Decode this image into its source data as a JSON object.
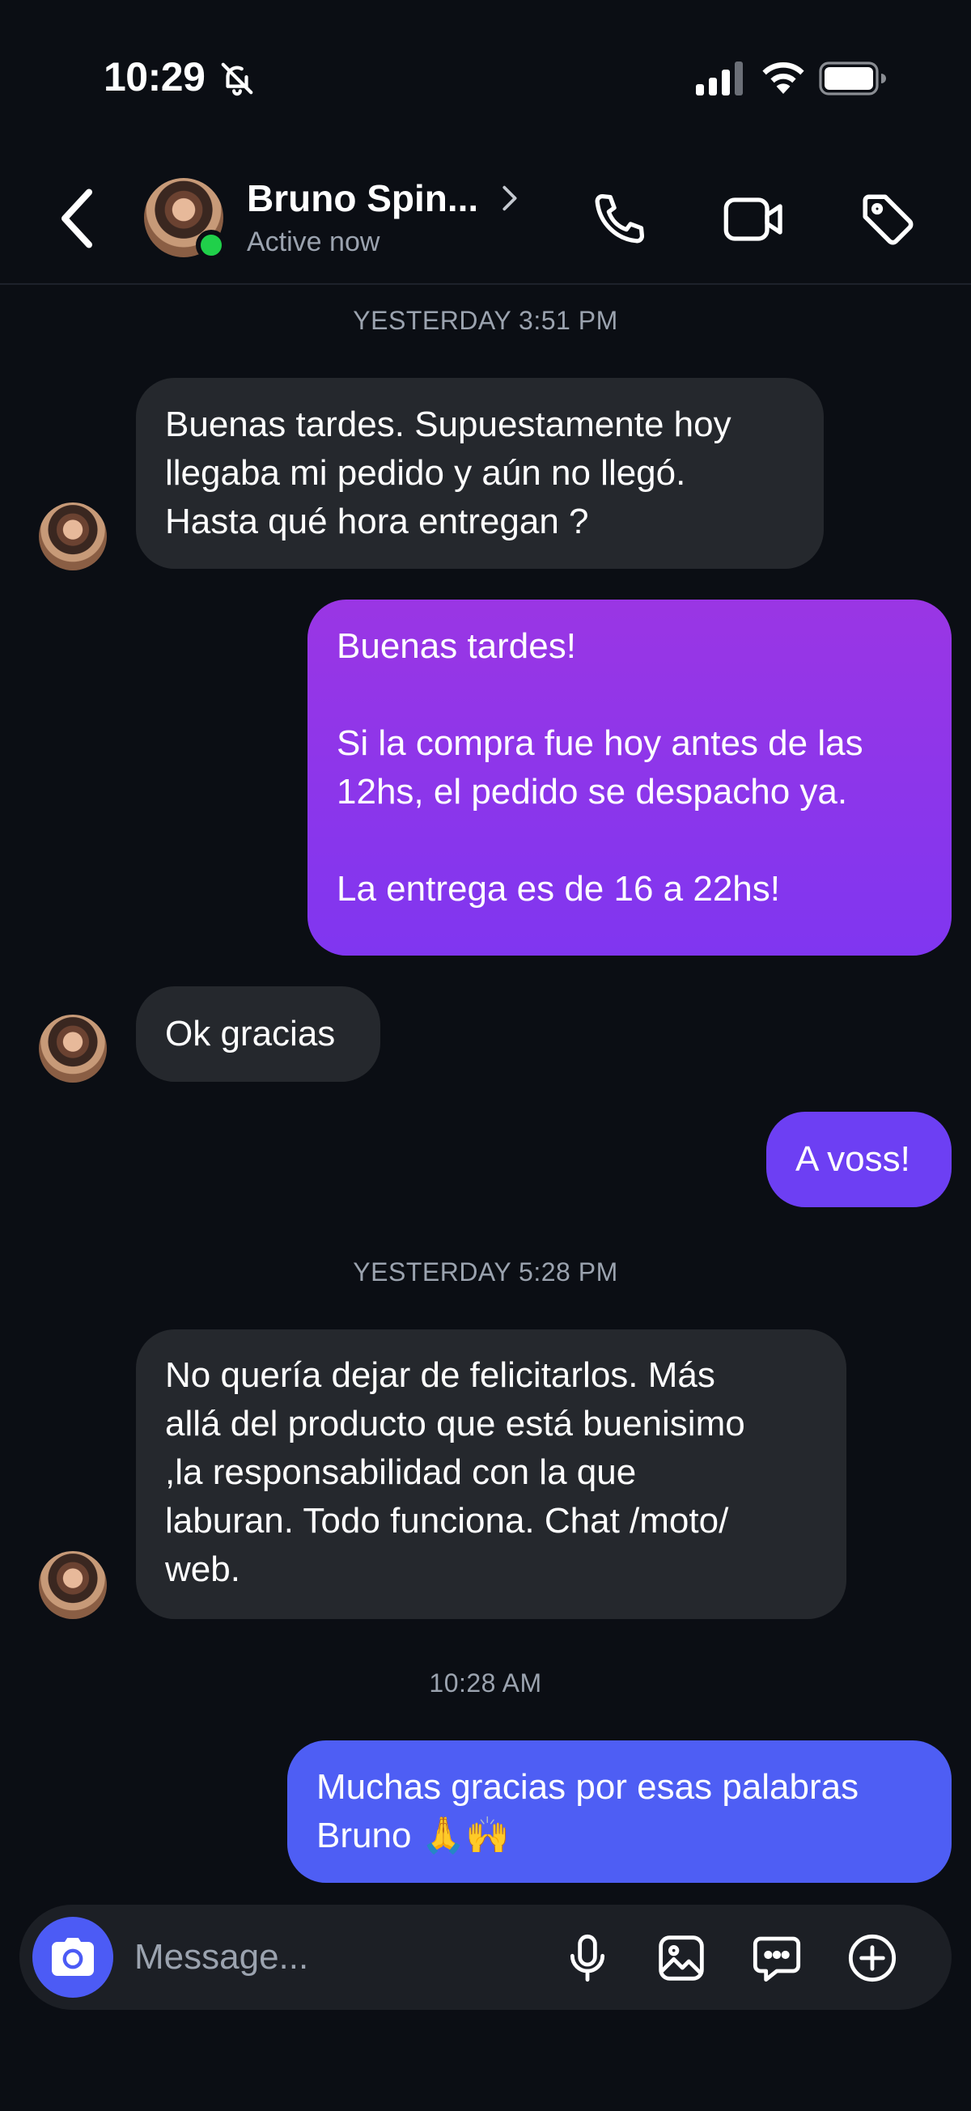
{
  "status_bar": {
    "time": "10:29"
  },
  "header": {
    "contact_name": "Bruno Spin...",
    "contact_status": "Active now"
  },
  "messages": [
    {
      "type": "timestamp",
      "text": "YESTERDAY 3:51 PM"
    },
    {
      "type": "incoming",
      "text": "Buenas tardes. Supuestamente hoy\nllegaba mi pedido y aún no llegó.\nHasta qué hora entregan ?"
    },
    {
      "type": "outgoing",
      "text": "Buenas tardes!\n\nSi la compra fue hoy antes de las\n12hs, el pedido se despacho ya.\n\nLa entrega es de 16 a 22hs!"
    },
    {
      "type": "incoming",
      "text": "Ok gracias"
    },
    {
      "type": "outgoing",
      "text": "A voss!"
    },
    {
      "type": "timestamp",
      "text": "YESTERDAY 5:28 PM"
    },
    {
      "type": "incoming",
      "text": "No quería dejar de felicitarlos. Más\nallá del producto que está buenisimo\n,la responsabilidad con la que\nlaburan. Todo funciona. Chat /moto/\nweb."
    },
    {
      "type": "timestamp",
      "text": "10:28 AM"
    },
    {
      "type": "outgoing",
      "text": "Muchas gracias por esas palabras\nBruno 🙏🙌"
    }
  ],
  "composer": {
    "placeholder": "Message..."
  },
  "colors": {
    "background": "#0b0e14",
    "incoming_bubble": "#25282d",
    "outgoing_gradient_top": "#9a36e4",
    "outgoing_gradient_bottom": "#4e5ef4",
    "online": "#20d04a",
    "camera_button": "#4c5bf5"
  },
  "icons": [
    "bell-off-icon",
    "signal-icon",
    "wifi-icon",
    "battery-icon",
    "back-icon",
    "chevron-right-icon",
    "phone-icon",
    "video-icon",
    "tag-icon",
    "camera-icon",
    "microphone-icon",
    "image-icon",
    "sticker-icon",
    "plus-circle-icon"
  ]
}
